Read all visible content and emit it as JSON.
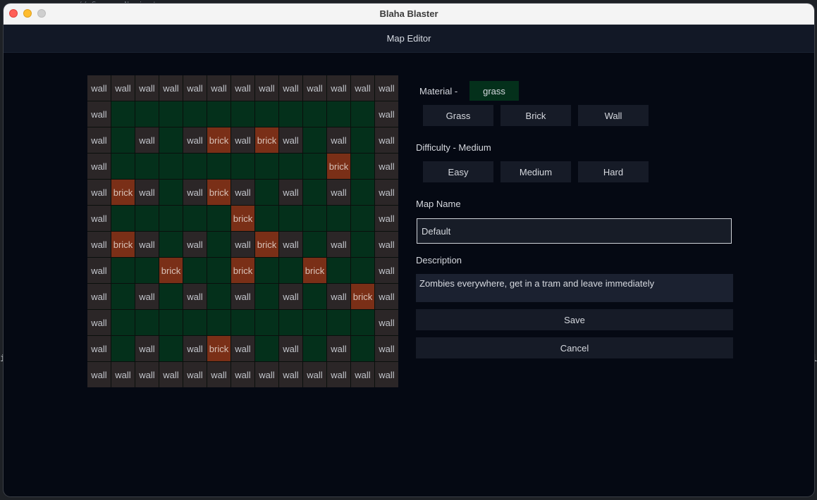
{
  "window": {
    "title": "Blaha Blaster"
  },
  "app": {
    "title": "Map Editor"
  },
  "map": {
    "rows": [
      [
        "wall",
        "wall",
        "wall",
        "wall",
        "wall",
        "wall",
        "wall",
        "wall",
        "wall",
        "wall",
        "wall",
        "wall",
        "wall"
      ],
      [
        "wall",
        "grass",
        "grass",
        "grass",
        "grass",
        "grass",
        "grass",
        "grass",
        "grass",
        "grass",
        "grass",
        "grass",
        "wall"
      ],
      [
        "wall",
        "grass",
        "wall",
        "grass",
        "wall",
        "brick",
        "wall",
        "brick",
        "wall",
        "grass",
        "wall",
        "grass",
        "wall"
      ],
      [
        "wall",
        "grass",
        "grass",
        "grass",
        "grass",
        "grass",
        "grass",
        "grass",
        "grass",
        "grass",
        "brick",
        "grass",
        "wall"
      ],
      [
        "wall",
        "brick",
        "wall",
        "grass",
        "wall",
        "brick",
        "wall",
        "grass",
        "wall",
        "grass",
        "wall",
        "grass",
        "wall"
      ],
      [
        "wall",
        "grass",
        "grass",
        "grass",
        "grass",
        "grass",
        "brick",
        "grass",
        "grass",
        "grass",
        "grass",
        "grass",
        "wall"
      ],
      [
        "wall",
        "brick",
        "wall",
        "grass",
        "wall",
        "grass",
        "wall",
        "brick",
        "wall",
        "grass",
        "wall",
        "grass",
        "wall"
      ],
      [
        "wall",
        "grass",
        "grass",
        "brick",
        "grass",
        "grass",
        "brick",
        "grass",
        "grass",
        "brick",
        "grass",
        "grass",
        "wall"
      ],
      [
        "wall",
        "grass",
        "wall",
        "grass",
        "wall",
        "grass",
        "wall",
        "grass",
        "wall",
        "grass",
        "wall",
        "brick",
        "wall"
      ],
      [
        "wall",
        "grass",
        "grass",
        "grass",
        "grass",
        "grass",
        "grass",
        "grass",
        "grass",
        "grass",
        "grass",
        "grass",
        "wall"
      ],
      [
        "wall",
        "grass",
        "wall",
        "grass",
        "wall",
        "brick",
        "wall",
        "grass",
        "wall",
        "grass",
        "wall",
        "grass",
        "wall"
      ],
      [
        "wall",
        "wall",
        "wall",
        "wall",
        "wall",
        "wall",
        "wall",
        "wall",
        "wall",
        "wall",
        "wall",
        "wall",
        "wall"
      ]
    ],
    "tile_labels": {
      "wall": "wall",
      "brick": "brick",
      "grass": ""
    },
    "tile_colors": {
      "wall": "#2b2627",
      "brick": "#7a2f17",
      "grass": "#04301b"
    }
  },
  "material": {
    "label": "Material -",
    "current": "grass",
    "options": [
      "Grass",
      "Brick",
      "Wall"
    ]
  },
  "difficulty": {
    "label": "Difficulty - Medium",
    "options": [
      "Easy",
      "Medium",
      "Hard"
    ]
  },
  "map_name": {
    "label": "Map Name",
    "value": "Default"
  },
  "description": {
    "label": "Description",
    "value": "Zombies everywhere, get in a tram and leave immediately"
  },
  "actions": {
    "save": "Save",
    "cancel": "Cancel"
  },
  "background": {
    "code_snippet": "//      Screen Navigator"
  }
}
